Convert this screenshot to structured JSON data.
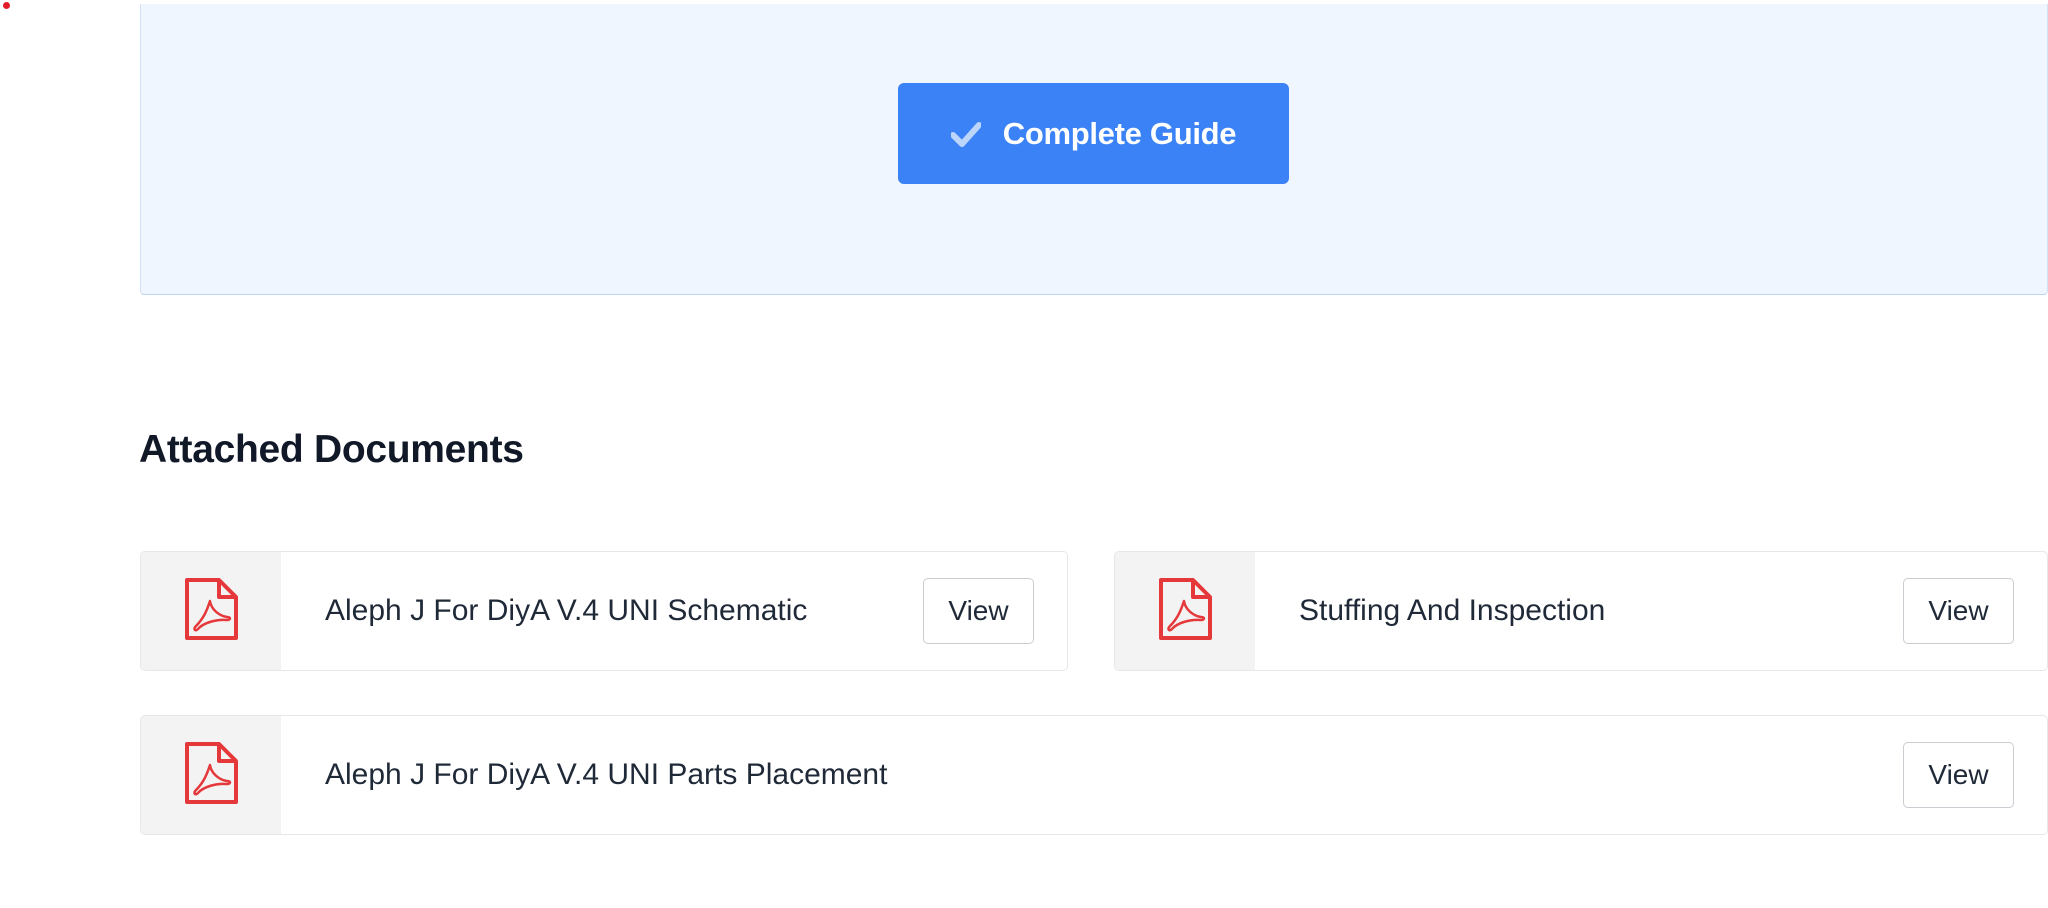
{
  "complete_panel": {
    "button_label": "Complete Guide",
    "button_icon": "check-icon",
    "button_color": "#3b82f6",
    "panel_color": "#eff6ff"
  },
  "attached_documents": {
    "title": "Attached Documents",
    "file_icon": "pdf-file-icon",
    "file_icon_color": "#e5383b",
    "items": [
      {
        "name": "Aleph J For DiyA V.4 UNI Schematic",
        "view_label": "View"
      },
      {
        "name": "Stuffing And Inspection",
        "view_label": "View"
      },
      {
        "name": "Aleph J For DiyA V.4 UNI Parts Placement",
        "view_label": "View"
      }
    ]
  }
}
